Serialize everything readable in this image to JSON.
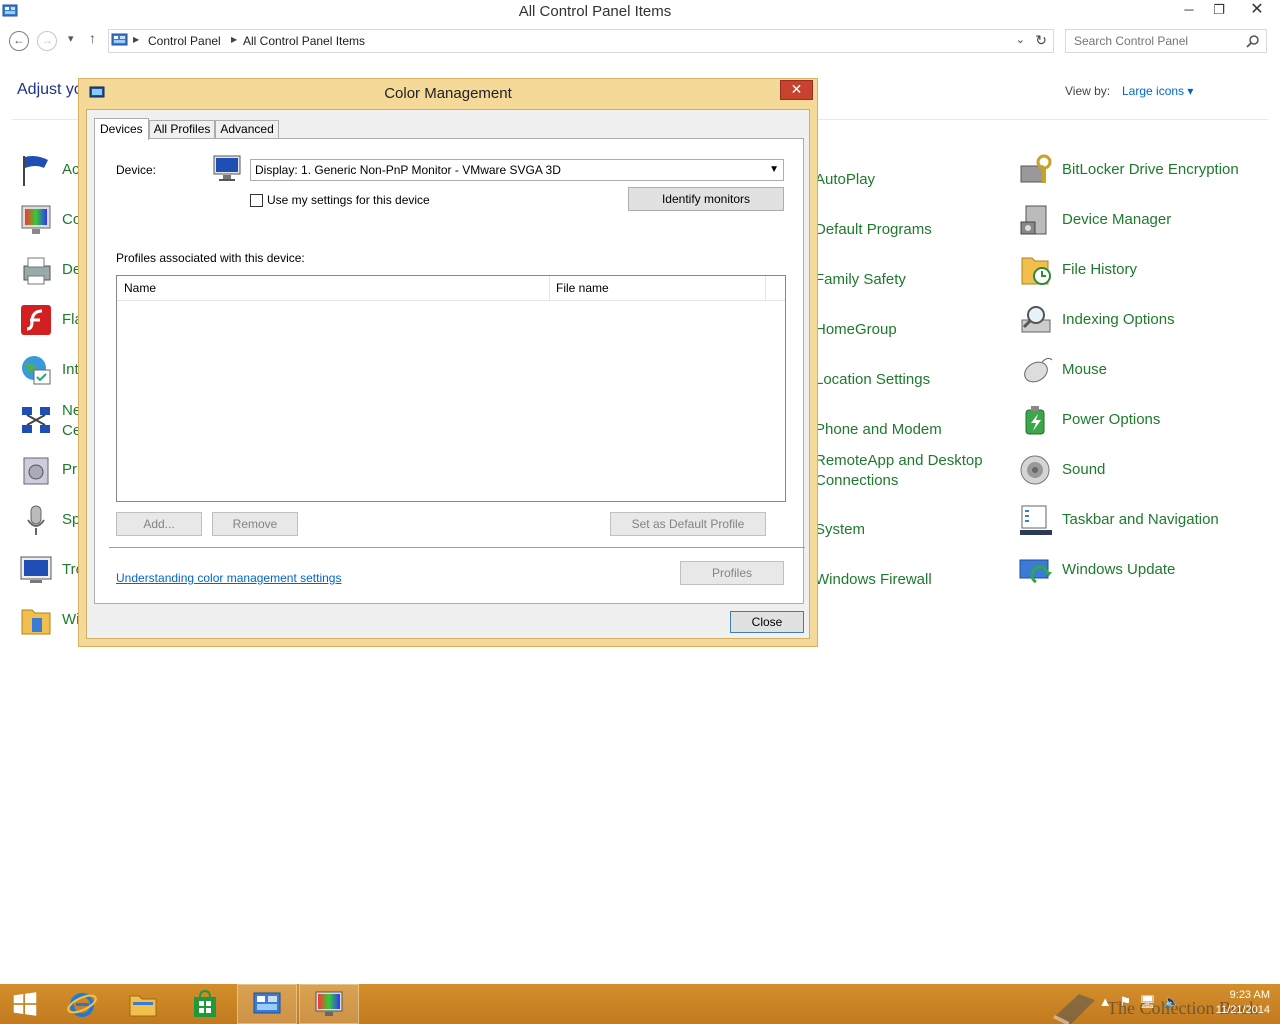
{
  "window": {
    "title": "All Control Panel Items",
    "min_glyph": "─",
    "max_glyph": "❐",
    "close_glyph": "✕"
  },
  "nav": {
    "back_glyph": "←",
    "forward_glyph": "→",
    "recent_glyph": "▾",
    "up_glyph": "↑",
    "breadcrumbs": [
      "Control Panel",
      "All Control Panel Items"
    ],
    "separator_glyph": "▶",
    "dropdown_glyph": "⌄",
    "refresh_glyph": "↻",
    "search_placeholder": "Search Control Panel"
  },
  "page": {
    "heading": "Adjust yo",
    "view_by_label": "View by:",
    "view_by_value": "Large icons ▾"
  },
  "left_column": [
    {
      "label": "Ac"
    },
    {
      "label": "Co"
    },
    {
      "label": "De"
    },
    {
      "label": "Fla"
    },
    {
      "label": "Int"
    },
    {
      "label": "Ne\nCe"
    },
    {
      "label": "Pr"
    },
    {
      "label": "Sp"
    },
    {
      "label": "Tro"
    },
    {
      "label": "Wi"
    }
  ],
  "middle_column": [
    {
      "label": "AutoPlay"
    },
    {
      "label": "Default Programs"
    },
    {
      "label": "Family Safety"
    },
    {
      "label": "HomeGroup"
    },
    {
      "label": "Location Settings"
    },
    {
      "label": "Phone and Modem"
    },
    {
      "label": "RemoteApp and Desktop\nConnections"
    },
    {
      "label": "System"
    },
    {
      "label": "Windows Firewall"
    }
  ],
  "right_column": [
    {
      "label": "BitLocker Drive Encryption"
    },
    {
      "label": "Device Manager"
    },
    {
      "label": "File History"
    },
    {
      "label": "Indexing Options"
    },
    {
      "label": "Mouse"
    },
    {
      "label": "Power Options"
    },
    {
      "label": "Sound"
    },
    {
      "label": "Taskbar and Navigation"
    },
    {
      "label": "Windows Update"
    }
  ],
  "dialog": {
    "title": "Color Management",
    "close_glyph": "✕",
    "tabs": [
      "Devices",
      "All Profiles",
      "Advanced"
    ],
    "device_label": "Device:",
    "device_value": "Display: 1. Generic Non-PnP Monitor - VMware SVGA 3D",
    "dropdown_glyph": "▼",
    "checkbox_label": "Use my settings for this device",
    "identify_button": "Identify monitors",
    "profiles_label": "Profiles associated with this device:",
    "columns": [
      "Name",
      "File name"
    ],
    "add_button": "Add...",
    "remove_button": "Remove",
    "set_default_button": "Set as Default Profile",
    "link": "Understanding color management settings",
    "profiles_button": "Profiles",
    "close_button": "Close"
  },
  "taskbar": {
    "clock_time": "9:23 AM",
    "clock_date": "11/21/2014",
    "tray_glyphs": [
      "▲",
      "⚑",
      "🖥",
      "🔈"
    ],
    "watermark": "The Collection Book"
  },
  "colors": {
    "link_green": "#1e7a2d",
    "dialog_frame": "#f5d999",
    "taskbar": "#c98420",
    "close_red": "#c7432f"
  }
}
